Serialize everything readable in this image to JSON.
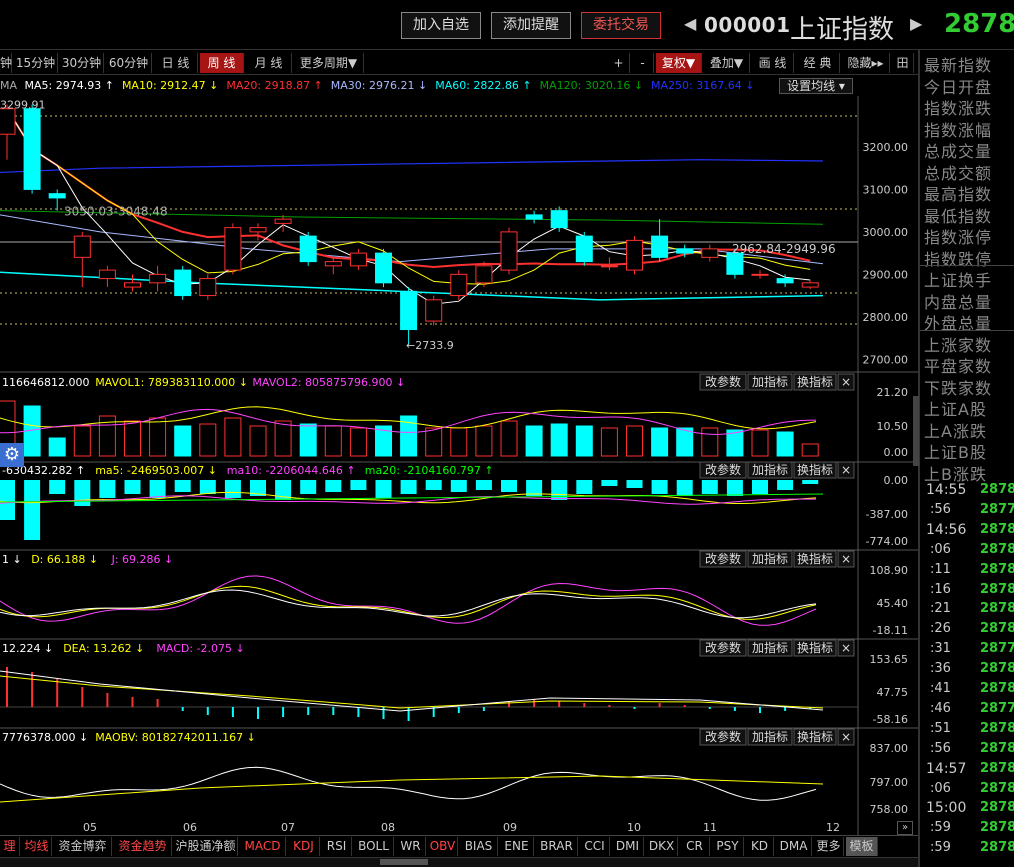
{
  "header": {
    "buttons": [
      "加入自选",
      "添加提醒",
      "委托交易"
    ],
    "code": "000001",
    "name": "上证指数",
    "price": "2878."
  },
  "toolbar": {
    "left_items": [
      "钟",
      "15分钟",
      "30分钟",
      "60分钟",
      "日 线",
      "周 线",
      "月 线",
      "更多周期▼"
    ],
    "right_items": [
      "+",
      "-",
      "复权▼",
      "叠加▼",
      "画 线",
      "经 典",
      "隐藏▸▸",
      "田"
    ]
  },
  "ma_legend": {
    "prefix": "MA",
    "items": [
      {
        "text": "MA5: 2974.93 ↑",
        "color": "#ffffff"
      },
      {
        "text": "MA10: 2912.47 ↓",
        "color": "#ffff00"
      },
      {
        "text": "MA20: 2918.87 ↑",
        "color": "#ff3030"
      },
      {
        "text": "MA30: 2976.21 ↓",
        "color": "#aab8ff"
      },
      {
        "text": "MA60: 2822.86 ↑",
        "color": "#00ffff"
      },
      {
        "text": "MA120: 3020.16 ↓",
        "color": "#00a000"
      },
      {
        "text": "MA250: 3167.64 ↓",
        "color": "#2233ff"
      }
    ],
    "settings": "设置均线 ▾"
  },
  "price_axis": [
    "3200.00",
    "3100.00",
    "3000.00",
    "2900.00",
    "2800.00",
    "2700.00"
  ],
  "price_annotations": {
    "top": "3299.91",
    "left": "3050.03-3048.48",
    "right": "2962.84-2949.96",
    "low": "2733.9"
  },
  "vol_legend": {
    "items": [
      {
        "text": "116646812.000",
        "color": "#ffffff"
      },
      {
        "text": "MAVOL1: 789383110.000 ↓",
        "color": "#ffff00"
      },
      {
        "text": "MAVOL2: 805875796.900 ↓",
        "color": "#ff44ff"
      }
    ],
    "axis": [
      "21.20",
      "10.50",
      "0.00"
    ]
  },
  "flow_legend": {
    "items": [
      {
        "text": "-630432.282 ↑",
        "color": "#ffffff"
      },
      {
        "text": "ma5: -2469503.007 ↓",
        "color": "#ffff00"
      },
      {
        "text": "ma10: -2206044.646 ↑",
        "color": "#ff44ff"
      },
      {
        "text": "ma20: -2104160.797 ↑",
        "color": "#00ff00"
      }
    ],
    "axis": [
      "0.00",
      "-387.00",
      "-774.00"
    ]
  },
  "kdj_legend": {
    "items": [
      {
        "text": "1 ↓",
        "color": "#ffffff"
      },
      {
        "text": "D: 66.188 ↓",
        "color": "#ffff00"
      },
      {
        "text": "J: 69.286 ↓",
        "color": "#ff44ff"
      }
    ],
    "axis": [
      "108.90",
      "45.40",
      "-18.11"
    ]
  },
  "macd_legend": {
    "items": [
      {
        "text": "12.224 ↓",
        "color": "#ffffff"
      },
      {
        "text": "DEA: 13.262 ↓",
        "color": "#ffff00"
      },
      {
        "text": "MACD: -2.075 ↓",
        "color": "#ff44ff"
      }
    ],
    "axis": [
      "153.65",
      "47.75",
      "-58.16"
    ]
  },
  "obv_legend": {
    "items": [
      {
        "text": "7776378.000 ↓",
        "color": "#ffffff"
      },
      {
        "text": "MAOBV: 80182742011.167 ↓",
        "color": "#ffff00"
      }
    ],
    "axis": [
      "837.00",
      "797.00",
      "758.00"
    ]
  },
  "panel_buttons": [
    "改参数",
    "加指标",
    "换指标",
    "×"
  ],
  "months": [
    "05",
    "06",
    "07",
    "08",
    "09",
    "10",
    "11",
    "12"
  ],
  "bottom_tabs": [
    "理",
    "均线",
    "资金博弈",
    "资金趋势",
    "沪股通净额",
    "MACD",
    "KDJ",
    "RSI",
    "BOLL",
    "WR",
    "OBV",
    "BIAS",
    "ENE",
    "BRAR",
    "CCI",
    "DMI",
    "DKX",
    "CR",
    "PSY",
    "KD",
    "DMA",
    "更多",
    "模板"
  ],
  "side_labels": [
    "最新指数",
    "今日开盘",
    "指数涨跌",
    "指数涨幅",
    "总成交量",
    "总成交额",
    "最高指数",
    "最低指数",
    "指数涨停",
    "指数跌停",
    "上证换手",
    "内盘总量",
    "外盘总量",
    "上涨家数",
    "平盘家数",
    "下跌家数",
    "上证A股",
    "上A涨跌",
    "上证B股",
    "上B涨跌"
  ],
  "ticks": [
    {
      "t": "14:55",
      "v": "2878",
      "big": true
    },
    {
      "t": ":56",
      "v": "2877",
      "big": false
    },
    {
      "t": "14:56",
      "v": "2878",
      "big": true
    },
    {
      "t": ":06",
      "v": "2878",
      "big": false
    },
    {
      "t": ":11",
      "v": "2878",
      "big": false
    },
    {
      "t": ":16",
      "v": "2878",
      "big": false
    },
    {
      "t": ":21",
      "v": "2878",
      "big": false
    },
    {
      "t": ":26",
      "v": "2878",
      "big": false
    },
    {
      "t": ":31",
      "v": "2877",
      "big": false
    },
    {
      "t": ":36",
      "v": "2878",
      "big": false
    },
    {
      "t": ":41",
      "v": "2878",
      "big": false
    },
    {
      "t": ":46",
      "v": "2877",
      "big": false
    },
    {
      "t": ":51",
      "v": "2878",
      "big": false
    },
    {
      "t": ":56",
      "v": "2878",
      "big": false
    },
    {
      "t": "14:57",
      "v": "2878",
      "big": true
    },
    {
      "t": ":06",
      "v": "2878",
      "big": false
    },
    {
      "t": "15:00",
      "v": "2878",
      "big": true
    },
    {
      "t": ":59",
      "v": "2878",
      "big": false
    },
    {
      "t": ":59",
      "v": "2878",
      "big": false
    }
  ],
  "chart_data": {
    "type": "candlestick",
    "period": "weekly",
    "candles": [
      {
        "o": 3230,
        "c": 3290,
        "h": 3300,
        "l": 3170
      },
      {
        "o": 3290,
        "c": 3100,
        "h": 3300,
        "l": 3090
      },
      {
        "o": 3090,
        "c": 3080,
        "h": 3100,
        "l": 3050
      },
      {
        "o": 2940,
        "c": 2990,
        "h": 3000,
        "l": 2870
      },
      {
        "o": 2890,
        "c": 2910,
        "h": 2920,
        "l": 2870
      },
      {
        "o": 2870,
        "c": 2880,
        "h": 2900,
        "l": 2860
      },
      {
        "o": 2880,
        "c": 2900,
        "h": 2920,
        "l": 2860
      },
      {
        "o": 2910,
        "c": 2850,
        "h": 2920,
        "l": 2840
      },
      {
        "o": 2850,
        "c": 2890,
        "h": 2900,
        "l": 2840
      },
      {
        "o": 2910,
        "c": 3010,
        "h": 3020,
        "l": 2900
      },
      {
        "o": 3000,
        "c": 3010,
        "h": 3020,
        "l": 2980
      },
      {
        "o": 3020,
        "c": 3030,
        "h": 3040,
        "l": 3000
      },
      {
        "o": 2990,
        "c": 2930,
        "h": 3000,
        "l": 2920
      },
      {
        "o": 2920,
        "c": 2930,
        "h": 2940,
        "l": 2900
      },
      {
        "o": 2920,
        "c": 2950,
        "h": 2960,
        "l": 2910
      },
      {
        "o": 2950,
        "c": 2880,
        "h": 2960,
        "l": 2870
      },
      {
        "o": 2860,
        "c": 2770,
        "h": 2870,
        "l": 2734
      },
      {
        "o": 2790,
        "c": 2840,
        "h": 2850,
        "l": 2780
      },
      {
        "o": 2850,
        "c": 2900,
        "h": 2910,
        "l": 2840
      },
      {
        "o": 2880,
        "c": 2920,
        "h": 2930,
        "l": 2870
      },
      {
        "o": 2910,
        "c": 3000,
        "h": 3010,
        "l": 2900
      },
      {
        "o": 3040,
        "c": 3030,
        "h": 3050,
        "l": 3020
      },
      {
        "o": 3050,
        "c": 3010,
        "h": 3060,
        "l": 3000
      },
      {
        "o": 2990,
        "c": 2930,
        "h": 3000,
        "l": 2920
      },
      {
        "o": 2920,
        "c": 2920,
        "h": 2940,
        "l": 2910
      },
      {
        "o": 2910,
        "c": 2980,
        "h": 2990,
        "l": 2900
      },
      {
        "o": 2990,
        "c": 2940,
        "h": 3030,
        "l": 2930
      },
      {
        "o": 2960,
        "c": 2950,
        "h": 2970,
        "l": 2940
      },
      {
        "o": 2940,
        "c": 2960,
        "h": 2970,
        "l": 2930
      },
      {
        "o": 2950,
        "c": 2900,
        "h": 2960,
        "l": 2890
      },
      {
        "o": 2900,
        "c": 2900,
        "h": 2910,
        "l": 2890
      },
      {
        "o": 2890,
        "c": 2880,
        "h": 2900,
        "l": 2870
      },
      {
        "o": 2870,
        "c": 2880,
        "h": 2885,
        "l": 2865
      }
    ],
    "ylim": [
      2670,
      3320
    ],
    "x_ticks": [
      "05",
      "06",
      "07",
      "08",
      "09",
      "10",
      "11",
      "12"
    ]
  }
}
